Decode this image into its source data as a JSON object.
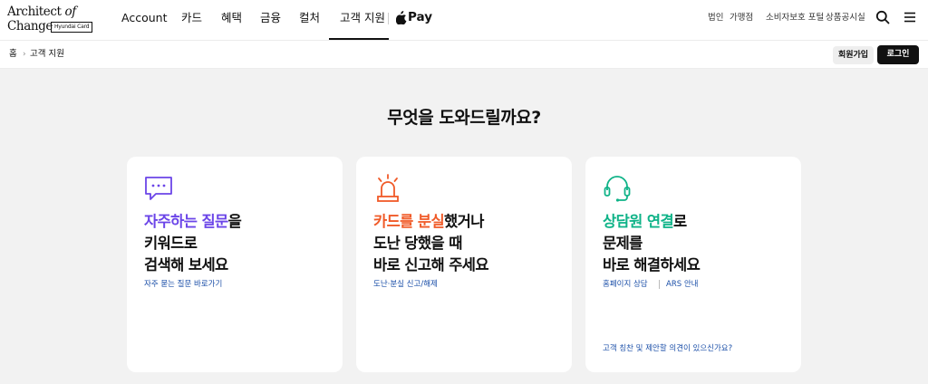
{
  "header": {
    "logo": {
      "line1_a": "Architect ",
      "line1_b": "of",
      "line2": "Change",
      "badge": "Hyundai Card"
    },
    "nav": [
      "Account",
      "카드",
      "혜택",
      "금융",
      "컬처",
      "고객 지원"
    ],
    "pay_label": "Pay",
    "utility": [
      "법인",
      "가맹점",
      "소비자보호 포털",
      "상품공시실"
    ]
  },
  "breadcrumb": {
    "home": "홈",
    "separator": "›",
    "current": "고객 지원"
  },
  "auth": {
    "join": "회원가입",
    "login": "로그인"
  },
  "main": {
    "title": "무엇을 도와드릴까요?"
  },
  "cards": [
    {
      "highlight": "자주하는 질문",
      "rest_line1": "을",
      "line2": "키워드로",
      "line3": "검색해 보세요",
      "link": "자주 묻는 질문 바로가기"
    },
    {
      "highlight": "카드를 분실",
      "rest_line1": "했거나",
      "line2": "도난 당했을 때",
      "line3": "바로 신고해 주세요",
      "link": "도난·분실 신고/해제"
    },
    {
      "highlight": "상담원 연결",
      "rest_line1": "로",
      "line2": "문제를",
      "line3": "바로 해결하세요",
      "link_a": "홈페이지 상담",
      "link_b": "ARS 안내",
      "bottom_link": "고객 칭찬 및 제안할 의견이 있으신가요?"
    }
  ],
  "colors": {
    "purple": "#6b45e8",
    "orange": "#f05a28",
    "green": "#0fb388",
    "link": "#1b4fa8"
  },
  "icons": [
    "chat-bubble-icon",
    "siren-icon",
    "headset-icon",
    "apple-icon",
    "search-icon",
    "menu-icon"
  ]
}
